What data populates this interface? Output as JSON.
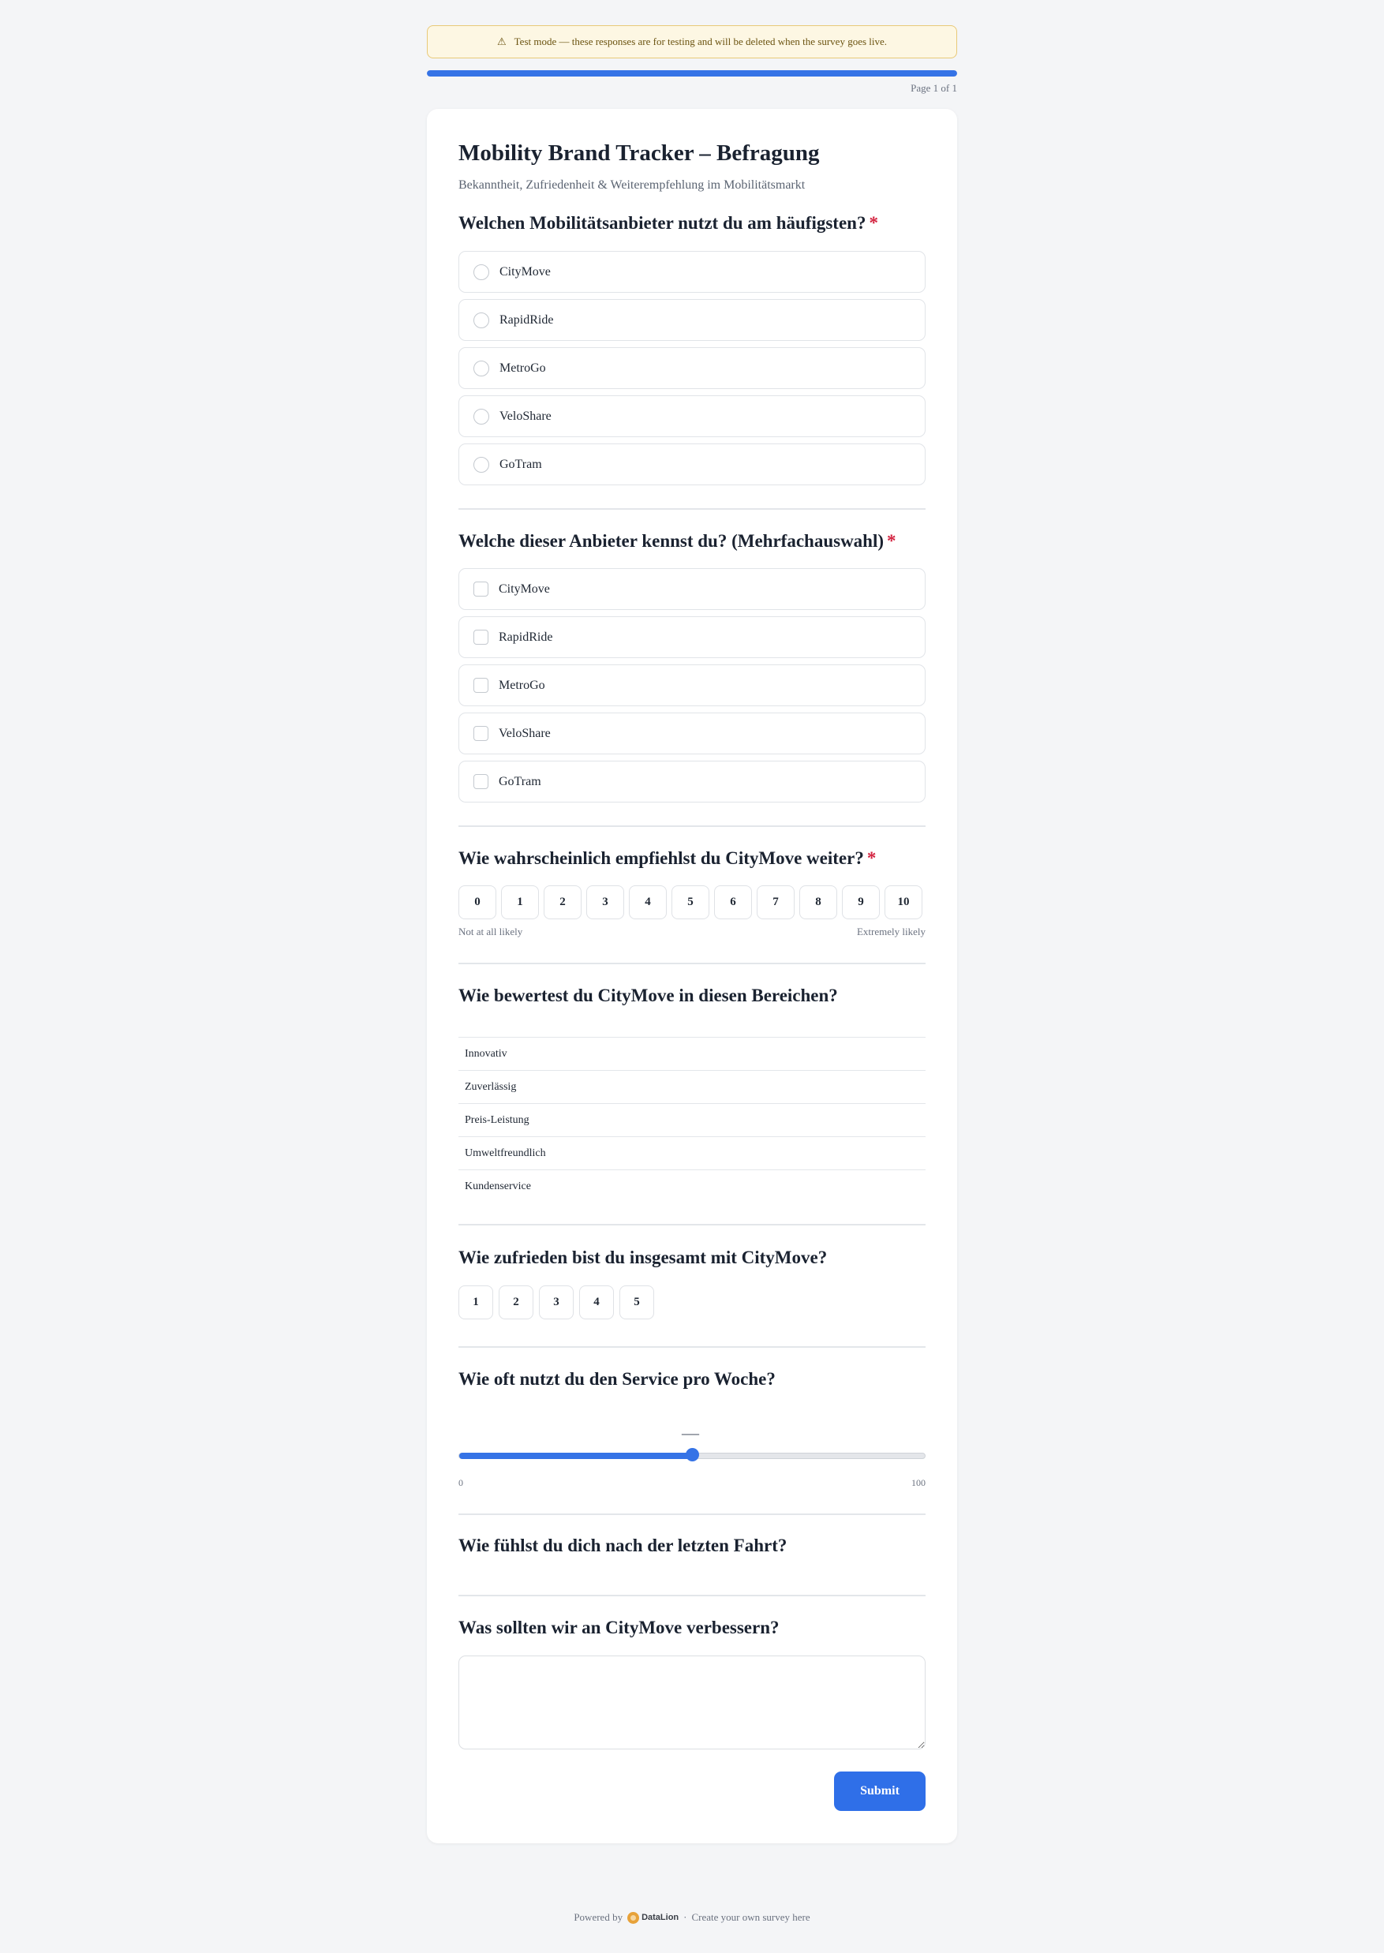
{
  "banner": {
    "icon": "warning-icon",
    "text": "Test mode — these responses are for testing and will be deleted when the survey goes live."
  },
  "progress": {
    "fraction": 1.0,
    "page_label": "Page 1 of 1"
  },
  "survey": {
    "title": "Mobility Brand Tracker – Befragung",
    "subtitle": "Bekanntheit, Zufriedenheit & Weiterempfehlung im Mobilitätsmarkt"
  },
  "q1": {
    "text": "Welchen Mobilitätsanbieter nutzt du am häufigsten?",
    "required": "*",
    "options": [
      "CityMove",
      "RapidRide",
      "MetroGo",
      "VeloShare",
      "GoTram"
    ]
  },
  "q2": {
    "text": "Welche dieser Anbieter kennst du? (Mehrfachauswahl)",
    "required": "*",
    "options": [
      "CityMove",
      "RapidRide",
      "MetroGo",
      "VeloShare",
      "GoTram"
    ]
  },
  "q3": {
    "text": "Wie wahrscheinlich empfiehlst du CityMove weiter?",
    "required": "*",
    "scale": [
      "0",
      "1",
      "2",
      "3",
      "4",
      "5",
      "6",
      "7",
      "8",
      "9",
      "10"
    ],
    "low_label": "Not at all likely",
    "high_label": "Extremely likely"
  },
  "q4": {
    "text": "Wie bewertest du CityMove in diesen Bereichen?",
    "rows": [
      "Innovativ",
      "Zuverlässig",
      "Preis-Leistung",
      "Umweltfreundlich",
      "Kundenservice"
    ]
  },
  "q5": {
    "text": "Wie zufrieden bist du insgesamt mit CityMove?",
    "scale": [
      "1",
      "2",
      "3",
      "4",
      "5"
    ]
  },
  "q6": {
    "text": "Wie oft nutzt du den Service pro Woche?",
    "value_display": "—",
    "min_label": "0",
    "max_label": "100",
    "position_fraction": 0.5
  },
  "q7": {
    "text": "Wie fühlst du dich nach der letzten Fahrt?"
  },
  "q8": {
    "text": "Was sollten wir an CityMove verbessern?",
    "value": ""
  },
  "submit_label": "Submit",
  "footer": {
    "powered_by": "Powered by",
    "brand": "DataLion",
    "separator": "·",
    "cta": "Create your own survey here"
  },
  "colors": {
    "accent": "#2f6fe8",
    "required": "#d3223f",
    "banner_bg": "#fdf7e3"
  }
}
